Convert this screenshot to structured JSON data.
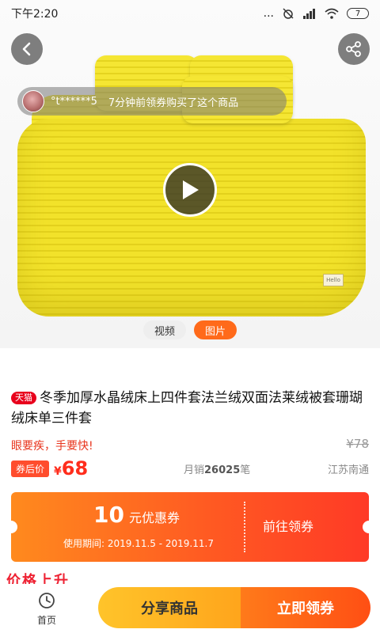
{
  "status_bar": {
    "time": "下午2:20",
    "dots": "...",
    "battery": "7"
  },
  "media": {
    "tabs": [
      {
        "label": "视频",
        "active": false
      },
      {
        "label": "图片",
        "active": true
      }
    ],
    "toast": {
      "name": "°t******5",
      "message": "7分钟前领券购买了这个商品"
    },
    "icons": {
      "back": "chevron-left-icon",
      "share": "share-icon",
      "play": "play-icon"
    },
    "tag_text": "Hello"
  },
  "product": {
    "badge": "天猫",
    "title": "冬季加厚水晶绒床上四件套法兰绒双面法莱绒被套珊瑚绒床单三件套",
    "slogan": "眼要疾，手要快!",
    "original_price": "¥78",
    "coupon_label": "券后价",
    "currency": "¥",
    "price": "68",
    "sales_prefix": "月销",
    "sales_count": "26025",
    "sales_suffix": "笔",
    "location": "江苏南通"
  },
  "coupon": {
    "amount": "10",
    "unit": "元优惠券",
    "period": "使用期间: 2019.11.5 - 2019.11.7",
    "action": "前往领券"
  },
  "below_fold": {
    "partial_heading": "价格上升"
  },
  "bottom_bar": {
    "home_label": "首页",
    "share_label": "分享商品",
    "claim_label": "立即领券"
  },
  "colors": {
    "accent": "#ff5a22",
    "price_red": "#ff2d1c",
    "tmall_red": "#e8001c",
    "share_yellow": "#ffb822"
  }
}
